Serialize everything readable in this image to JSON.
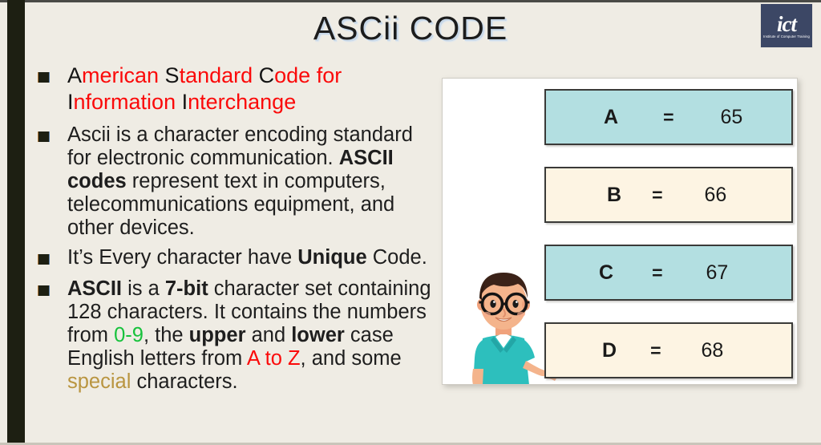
{
  "slide": {
    "title": "ASCii CODE",
    "background_color": "#efece4",
    "accent_stripe_color": "#1d1f12"
  },
  "logo": {
    "mark": "ict",
    "subtitle": "Institute of Computer Training",
    "background_color": "#3c4765"
  },
  "bullets": [
    {
      "id": "expansion",
      "segments": [
        {
          "text": "A",
          "style": "black"
        },
        {
          "text": "merican ",
          "style": "red"
        },
        {
          "text": "S",
          "style": "black"
        },
        {
          "text": "tandard ",
          "style": "red"
        },
        {
          "text": "C",
          "style": "black"
        },
        {
          "text": "ode for ",
          "style": "red"
        },
        {
          "text": "I",
          "style": "black"
        },
        {
          "text": "nformation ",
          "style": "red"
        },
        {
          "text": "I",
          "style": "black"
        },
        {
          "text": "nterchange",
          "style": "red"
        }
      ]
    },
    {
      "id": "definition",
      "segments": [
        {
          "text": "Ascii is a character encoding standard for electronic communication. ",
          "style": "plain"
        },
        {
          "text": "ASCII codes",
          "style": "bold"
        },
        {
          "text": " represent text in computers, telecommunications equipment, and other devices.",
          "style": "plain"
        }
      ]
    },
    {
      "id": "unique-code",
      "segments": [
        {
          "text": "It’s Every character have ",
          "style": "plain"
        },
        {
          "text": "Unique",
          "style": "bold"
        },
        {
          "text": " Code.",
          "style": "plain"
        }
      ]
    },
    {
      "id": "character-set",
      "segments": [
        {
          "text": "ASCII",
          "style": "bold"
        },
        {
          "text": " is a ",
          "style": "plain"
        },
        {
          "text": "7-bit",
          "style": "bold"
        },
        {
          "text": " character set containing 128 characters. It contains the numbers from ",
          "style": "plain"
        },
        {
          "text": "0-9",
          "style": "green"
        },
        {
          "text": ", the ",
          "style": "plain"
        },
        {
          "text": "upper",
          "style": "bold"
        },
        {
          "text": " and ",
          "style": "plain"
        },
        {
          "text": "lower",
          "style": "bold"
        },
        {
          "text": " case English letters from ",
          "style": "plain"
        },
        {
          "text": "A to Z",
          "style": "red"
        },
        {
          "text": ", and some ",
          "style": "plain"
        },
        {
          "text": "special",
          "style": "gold"
        },
        {
          "text": " characters.",
          "style": "plain"
        }
      ]
    }
  ],
  "ascii_table": {
    "equals_symbol": "=",
    "rows": [
      {
        "letter": "A",
        "code": "65",
        "fill": "#b3dfe1"
      },
      {
        "letter": "B",
        "code": "66",
        "fill": "#fdf4e3"
      },
      {
        "letter": "C",
        "code": "67",
        "fill": "#b3dfe1"
      },
      {
        "letter": "D",
        "code": "68",
        "fill": "#fdf4e3"
      }
    ]
  },
  "illustration": {
    "name": "presenter-character",
    "hair_color": "#3b2218",
    "skin_color": "#f4b48c",
    "shirt_color": "#2dbfbd",
    "glasses_color": "#1a1a1a"
  },
  "colors": {
    "red": "#fb0a0a",
    "green": "#17c23c",
    "gold": "#b99540",
    "teal_row": "#b3dfe1",
    "cream_row": "#fdf4e3",
    "text": "#1e1e1e"
  }
}
